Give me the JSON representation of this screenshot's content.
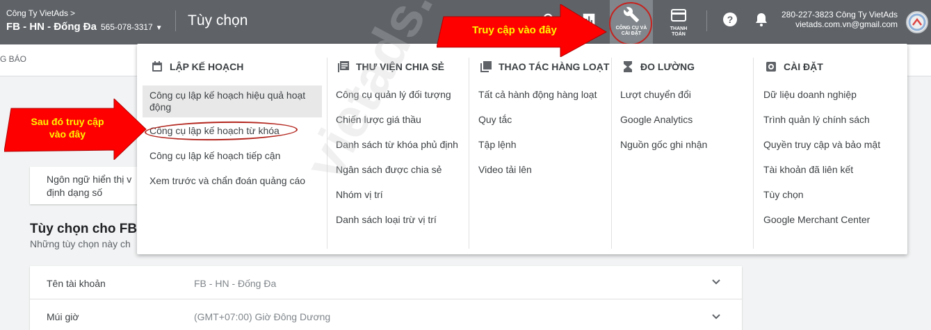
{
  "header": {
    "company": "Công Ty VietAds",
    "account_name": "FB - HN - Đống Đa",
    "account_id": "565-078-3317",
    "page_title": "Tùy chọn",
    "tools_label_1": "CÔNG CỤ VÀ",
    "tools_label_2": "CÀI ĐẶT",
    "billing_label_1": "THANH",
    "billing_label_2": "TOÁN",
    "user_line1": "280-227-3823 Công Ty VietAds",
    "user_email": "vietads.com.vn@gmail.com"
  },
  "subbar": {
    "tab": "G BÁO"
  },
  "background": {
    "lang_label_1": "Ngôn ngữ hiển thị v",
    "lang_label_2": "định dạng số",
    "section_title": "Tùy chọn cho FB",
    "section_sub": "Những tùy chọn này ch",
    "rows": [
      {
        "label": "Tên tài khoản",
        "value": "FB - HN - Đống Đa"
      },
      {
        "label": "Múi giờ",
        "value": "(GMT+07:00) Giờ Đông Dương"
      }
    ]
  },
  "menu": {
    "columns": [
      {
        "title": "LẬP KẾ HOẠCH",
        "icon": "calendar-icon",
        "items": [
          "Công cụ lập kế hoạch hiệu quả hoạt động",
          "Công cụ lập kế hoạch từ khóa",
          "Công cụ lập kế hoạch tiếp cận",
          "Xem trước và chẩn đoán quảng cáo"
        ]
      },
      {
        "title": "THƯ VIỆN CHIA SẺ",
        "icon": "library-icon",
        "items": [
          "Công cụ quản lý đối tượng",
          "Chiến lược giá thầu",
          "Danh sách từ khóa phủ định",
          "Ngân sách được chia sẻ",
          "Nhóm vị trí",
          "Danh sách loại trừ vị trí"
        ]
      },
      {
        "title": "THAO TÁC HÀNG LOẠT",
        "icon": "copy-icon",
        "items": [
          "Tất cả hành động hàng loạt",
          "Quy tắc",
          "Tập lệnh",
          "Video tải lên"
        ]
      },
      {
        "title": "ĐO LƯỜNG",
        "icon": "hourglass-icon",
        "items": [
          "Lượt chuyển đổi",
          "Google Analytics",
          "Nguồn gốc ghi nhận"
        ]
      },
      {
        "title": "CÀI ĐẶT",
        "icon": "settings-icon",
        "items": [
          "Dữ liệu doanh nghiệp",
          "Trình quản lý chính sách",
          "Quyền truy cập và bảo mật",
          "Tài khoản đã liên kết",
          "Tùy chọn",
          "Google Merchant Center"
        ]
      }
    ]
  },
  "annotations": {
    "arrow_top": "Truy cập vào đây",
    "arrow_left_1": "Sau đó truy cập",
    "arrow_left_2": "vào đây",
    "watermark": "vietads.com.vn"
  },
  "colors": {
    "topbar": "#5f6368",
    "arrow_red": "#ff0000",
    "arrow_text": "#fff700"
  }
}
